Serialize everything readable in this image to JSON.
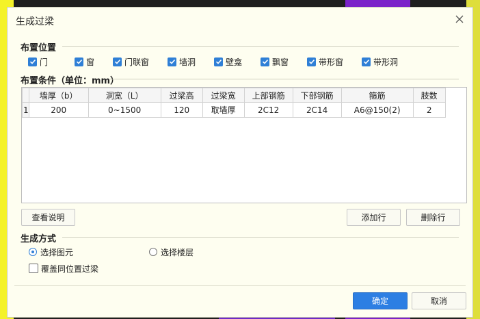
{
  "dialog": {
    "title": "生成过梁"
  },
  "placement": {
    "section_label": "布置位置",
    "options": [
      {
        "label": "门",
        "checked": true
      },
      {
        "label": "窗",
        "checked": true
      },
      {
        "label": "门联窗",
        "checked": true
      },
      {
        "label": "墙洞",
        "checked": true
      },
      {
        "label": "壁龛",
        "checked": true
      },
      {
        "label": "飘窗",
        "checked": true
      },
      {
        "label": "带形窗",
        "checked": true
      },
      {
        "label": "带形洞",
        "checked": true
      }
    ]
  },
  "conditions": {
    "section_label": "布置条件（单位：mm）",
    "columns": [
      "墙厚（b）",
      "洞宽（L）",
      "过梁高",
      "过梁宽",
      "上部钢筋",
      "下部钢筋",
      "箍筋",
      "肢数"
    ],
    "rows": [
      {
        "row_no": "1",
        "cells": [
          "200",
          "0~1500",
          "120",
          "取墙厚",
          "2C12",
          "2C14",
          "A6@150(2)",
          "2"
        ]
      }
    ]
  },
  "buttons": {
    "view_help": "查看说明",
    "add_row": "添加行",
    "delete_row": "删除行",
    "ok": "确定",
    "cancel": "取消"
  },
  "generate": {
    "section_label": "生成方式",
    "select_elements": "选择图元",
    "select_floor": "选择楼层",
    "selected": "select_elements",
    "overwrite_label": "覆盖同位置过梁",
    "overwrite_checked": false
  },
  "colors": {
    "accent": "#2d7fe3",
    "checkbox": "#2f7fd6",
    "dialog_bg": "#fefef0"
  }
}
